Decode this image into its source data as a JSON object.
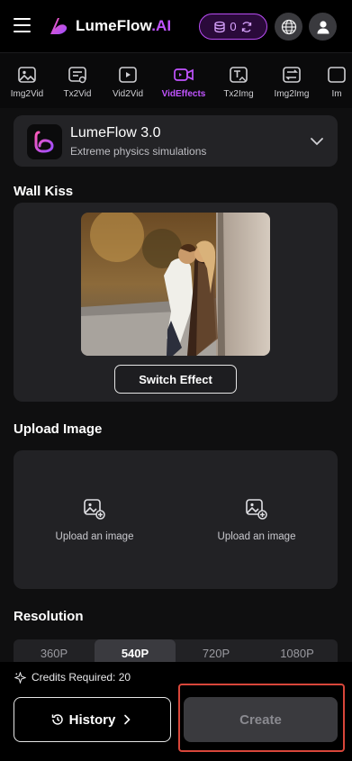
{
  "header": {
    "brand_name": "LumeFlow",
    "brand_suffix": ".AI",
    "credits_count": "0",
    "accent_color": "#c154ff",
    "icons": [
      "menu-icon",
      "logo-icon",
      "coin-stack-icon",
      "refresh-icon",
      "globe-icon",
      "user-icon"
    ]
  },
  "tabs": [
    {
      "label": "Img2Vid",
      "icon": "image-icon"
    },
    {
      "label": "Tx2Vid",
      "icon": "text-video-icon"
    },
    {
      "label": "Vid2Vid",
      "icon": "video-play-icon"
    },
    {
      "label": "VidEffects",
      "icon": "video-camera-icon",
      "active": true
    },
    {
      "label": "Tx2Img",
      "icon": "text-image-icon"
    },
    {
      "label": "Img2Img",
      "icon": "image-swap-icon"
    },
    {
      "label": "Im",
      "icon": "image-icon"
    }
  ],
  "model": {
    "name": "LumeFlow 3.0",
    "description": "Extreme physics simulations"
  },
  "effect": {
    "title": "Wall Kiss",
    "switch_label": "Switch Effect"
  },
  "upload": {
    "title": "Upload Image",
    "slots": [
      {
        "label": "Upload an image"
      },
      {
        "label": "Upload an image"
      }
    ]
  },
  "resolution": {
    "title": "Resolution",
    "options": [
      "360P",
      "540P",
      "720P",
      "1080P"
    ],
    "selected": "540P"
  },
  "footer": {
    "credits_required": "Credits Required: 20",
    "history_label": "History",
    "create_label": "Create"
  }
}
